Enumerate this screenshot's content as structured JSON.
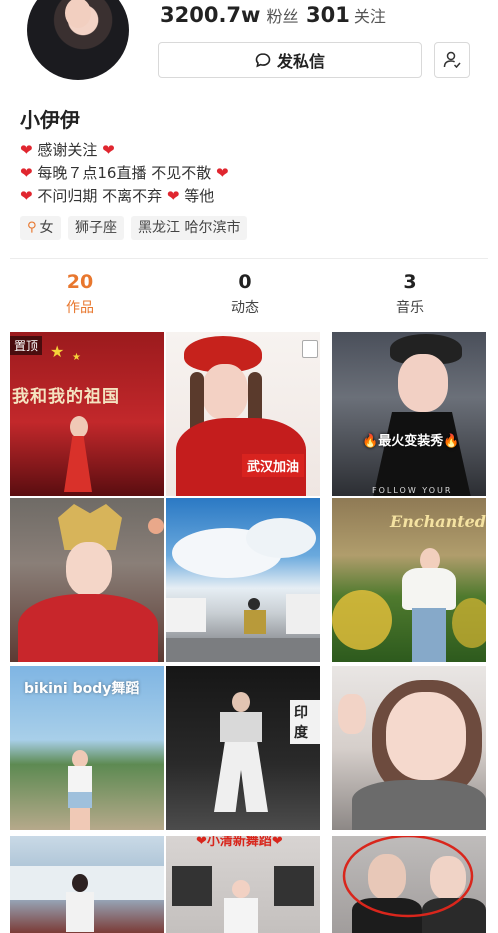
{
  "profile": {
    "fans_count": "3200.7w",
    "fans_label": "粉丝",
    "following_count": "301",
    "following_label": "关注",
    "message_button": "发私信",
    "name": "小伊伊",
    "bio_lines": [
      "感谢关注",
      "每晚７点16直播 不见不散",
      "不问归期 不离不弃",
      "等他"
    ],
    "tags": [
      "女",
      "狮子座",
      "黑龙江 哈尔滨市"
    ]
  },
  "tabs": [
    {
      "count": "20",
      "label": "作品"
    },
    {
      "count": "0",
      "label": "动态"
    },
    {
      "count": "3",
      "label": "音乐"
    }
  ],
  "grid": {
    "pinned_label": "置顶",
    "captions": {
      "v1": "我和我的祖国",
      "v2": "武汉加油",
      "v3": "最火变装秀",
      "v3_sub": "FOLLOW YOUR",
      "v6_sign": "Enchanted",
      "v7": "bikini body舞蹈",
      "v8": "印度",
      "v11": "小清新舞蹈"
    }
  },
  "colors": {
    "accent": "#e8772e",
    "heart": "#e0262f",
    "annotation_circle": "#d9261c"
  }
}
